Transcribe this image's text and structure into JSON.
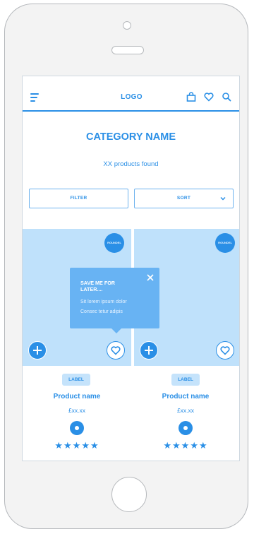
{
  "header": {
    "logo": "LOGO",
    "icons": [
      "menu-icon",
      "bag-icon",
      "heart-icon",
      "search-icon"
    ]
  },
  "category": {
    "title": "CATEGORY NAME",
    "count_text": "XX products found"
  },
  "controls": {
    "filter_label": "FILTER",
    "sort_label": "SORT"
  },
  "tooltip": {
    "title": "SAVE ME FOR LATER....",
    "line1": "Sit lorem ipsum dolor",
    "line2": "Consec tetur adipis"
  },
  "products": [
    {
      "badge": "ROUNDEL",
      "label": "LABEL",
      "name": "Product name",
      "price": "£xx.xx",
      "rating": 5
    },
    {
      "badge": "ROUNDEL",
      "label": "LABEL",
      "name": "Product name",
      "price": "£xx.xx",
      "rating": 5
    }
  ],
  "colors": {
    "accent": "#2a8fe6",
    "image_bg": "#bfe1fb",
    "tooltip_bg": "#68b3f3"
  }
}
